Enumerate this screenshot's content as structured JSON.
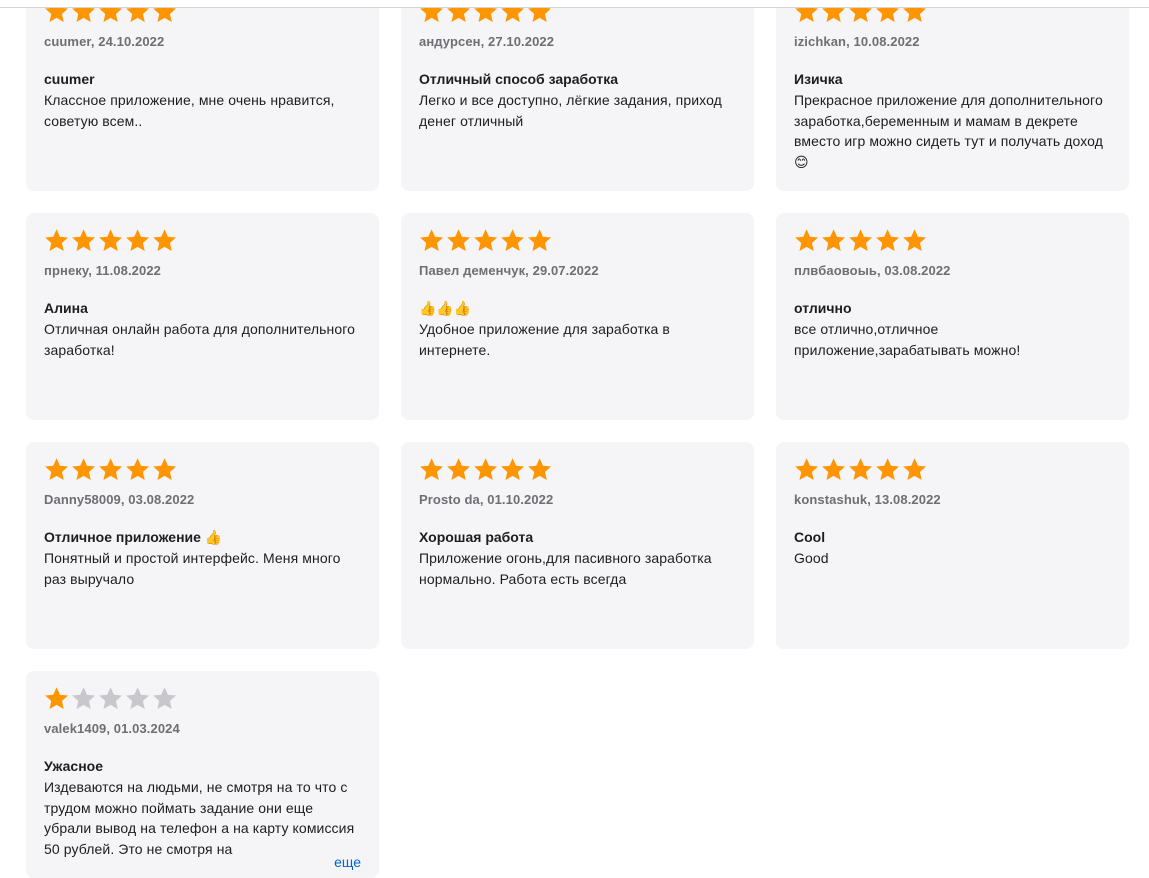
{
  "colors": {
    "star_filled": "#ff9500",
    "star_empty": "#c7c7cc",
    "card_bg": "#f5f5f7",
    "link": "#0066cc"
  },
  "reviews": [
    {
      "rating": 5,
      "meta": "cuumer, 24.10.2022",
      "title": "cuumer",
      "body": "Классное приложение, мне очень нравится, советую всем.."
    },
    {
      "rating": 5,
      "meta": "андурсен, 27.10.2022",
      "title": "Отличный способ заработка",
      "body": "Легко и все доступно, лёгкие задания, приход денег отличный"
    },
    {
      "rating": 5,
      "meta": "izichkan, 10.08.2022",
      "title": "Изичка",
      "body": "Прекрасное приложение для дополнительного заработка,беременным и мамам в декрете вместо игр можно сидеть тут и получать доход😊"
    },
    {
      "rating": 5,
      "meta": "прнеку, 11.08.2022",
      "title": "Алина",
      "body": "Отличная онлайн работа для дополнительного заработка!"
    },
    {
      "rating": 5,
      "meta": "Павел деменчук, 29.07.2022",
      "title": "👍👍👍",
      "body": "Удобное приложение для заработка в интернете."
    },
    {
      "rating": 5,
      "meta": "плвбаовоыь, 03.08.2022",
      "title": "отлично",
      "body": "все отлично,отличное приложение,зарабатывать можно!"
    },
    {
      "rating": 5,
      "meta": "Danny58009, 03.08.2022",
      "title": "Отличное приложение 👍",
      "body": "Понятный и простой интерфейс. Меня много раз выручало"
    },
    {
      "rating": 5,
      "meta": "Prosto da, 01.10.2022",
      "title": "Хорошая работа",
      "body": "Приложение огонь,для пасивного заработка нормально. Работа есть всегда"
    },
    {
      "rating": 5,
      "meta": "konstashuk, 13.08.2022",
      "title": "Cool",
      "body": "Good"
    },
    {
      "rating": 1,
      "meta": "valek1409, 01.03.2024",
      "title": "Ужасное",
      "body": "Издеваются на людьми, не смотря на то что с трудом можно поймать задание они еще убрали вывод на телефон а на карту комиссия 50 рублей. Это не смотря на",
      "more_label": "еще"
    }
  ]
}
